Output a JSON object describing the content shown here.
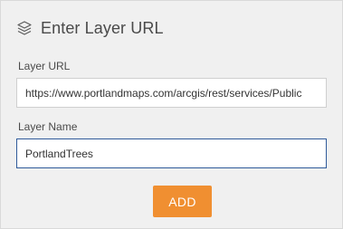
{
  "dialog": {
    "title": "Enter Layer URL",
    "header_icon": "layers-icon"
  },
  "form": {
    "url_label": "Layer URL",
    "url_value": "https://www.portlandmaps.com/arcgis/rest/services/Public",
    "name_label": "Layer Name",
    "name_value": "PortlandTrees",
    "add_button_label": "ADD"
  },
  "colors": {
    "accent": "#f08f31",
    "focus_border": "#2f5a9a",
    "panel_background": "#f0f0f0"
  }
}
